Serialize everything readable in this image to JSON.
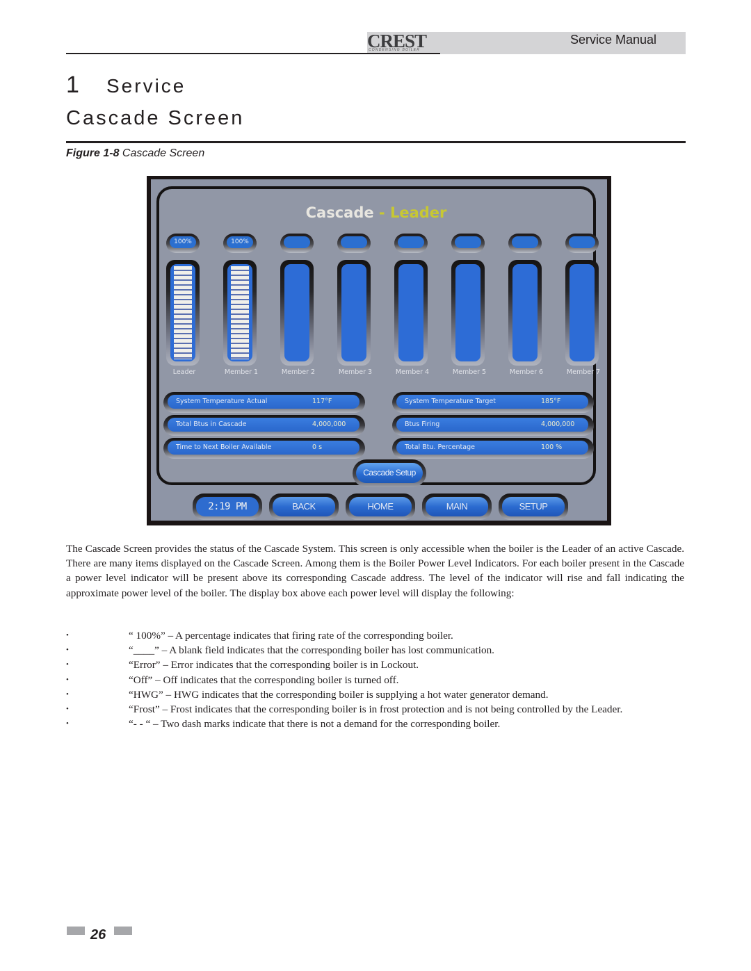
{
  "header": {
    "logo_main": "CREST",
    "logo_sub": "CONDENSING BOILER",
    "title": "Service Manual"
  },
  "chapter": {
    "number": "1",
    "title": "Service"
  },
  "section_title": "Cascade Screen",
  "figure": {
    "label": "Figure 1-8",
    "caption": "Cascade Screen"
  },
  "screen": {
    "title": "Cascade",
    "title_accent": "- Leader",
    "columns": [
      {
        "label": "Leader",
        "display": "100%",
        "level_percent": 100
      },
      {
        "label": "Member 1",
        "display": "100%",
        "level_percent": 100
      },
      {
        "label": "Member 2",
        "display": "",
        "level_percent": 0
      },
      {
        "label": "Member 3",
        "display": "",
        "level_percent": 0
      },
      {
        "label": "Member 4",
        "display": "",
        "level_percent": 0
      },
      {
        "label": "Member 5",
        "display": "",
        "level_percent": 0
      },
      {
        "label": "Member 6",
        "display": "",
        "level_percent": 0
      },
      {
        "label": "Member 7",
        "display": "",
        "level_percent": 0
      }
    ],
    "info_left": [
      {
        "label": "System Temperature Actual",
        "value": "117°F"
      },
      {
        "label": "Total Btus in Cascade",
        "value": "4,000,000"
      },
      {
        "label": "Time to Next Boiler Available",
        "value": "0  s"
      }
    ],
    "info_right": [
      {
        "label": "System Temperature Target",
        "value": "185°F"
      },
      {
        "label": "Btus Firing",
        "value": "4,000,000"
      },
      {
        "label": "Total Btu. Percentage",
        "value": "100 %"
      }
    ],
    "cascade_setup_label": "Cascade Setup",
    "clock": "2:19 PM",
    "nav": {
      "back": "BACK",
      "home": "HOME",
      "main": "MAIN",
      "setup": "SETUP"
    },
    "colors": {
      "accent_blue": "#2d6cd6",
      "leader_yellow": "#c8c832",
      "panel_gray": "#9197a6"
    }
  },
  "body_paragraph": "The Cascade Screen provides the status of the Cascade System.  This screen is only accessible when the boiler is the Leader of an active Cascade. There are many items displayed on the Cascade Screen.  Among them is the Boiler Power Level Indicators. For each boiler present in the Cascade a power level indicator will be present above its corresponding Cascade address.  The level of the indicator will rise and fall indicating the approximate power level of the boiler.  The display box above each power level will display the following:",
  "bullets": [
    "“ 100%” – A percentage indicates that firing rate of the corresponding boiler.",
    "“____” – A blank field indicates that the corresponding boiler has lost communication.",
    "“Error” – Error indicates that the corresponding boiler is in Lockout.",
    "“Off” – Off indicates that the corresponding boiler is turned off.",
    "“HWG” – HWG indicates that the corresponding boiler is supplying a hot water generator demand.",
    "“Frost”  –  Frost  indicates  that  the  corresponding  boiler  is  in  frost  protection  and  is  not  being controlled by the Leader.",
    "“- - “ – Two dash marks indicate that there is not a demand for the corresponding boiler."
  ],
  "bullet_glyph": "•",
  "page_number": "26"
}
